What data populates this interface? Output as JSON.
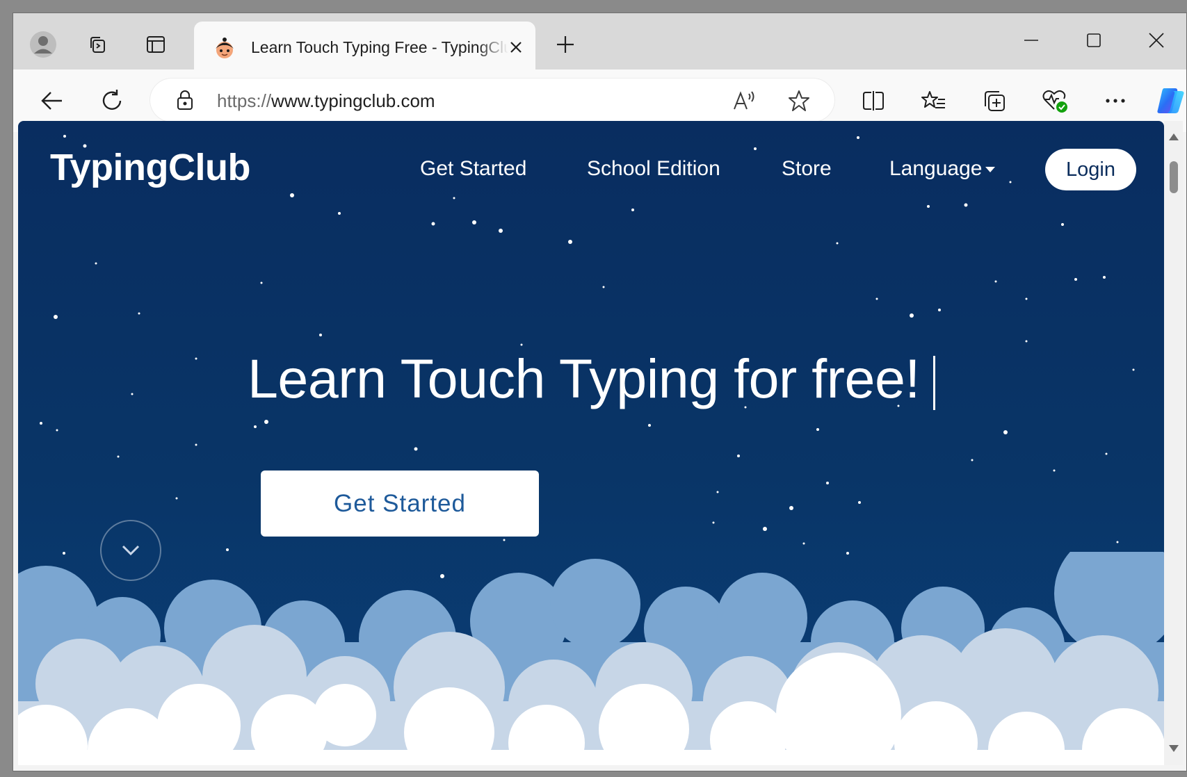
{
  "browser": {
    "tab": {
      "title": "Learn Touch Typing Free - TypingClub"
    },
    "address_bar": {
      "url_protocol": "https://",
      "url_host": "www.typingclub.com"
    },
    "icons": [
      "profile-icon",
      "workspaces-icon",
      "tab-actions-icon",
      "close-icon",
      "plus-icon",
      "back-icon",
      "reload-icon",
      "lock-icon",
      "read-aloud-icon",
      "star-icon",
      "split-screen-icon",
      "favorites-icon",
      "collections-icon",
      "browser-essentials-icon",
      "more-icon",
      "copilot-icon"
    ]
  },
  "site": {
    "logo": "TypingClub",
    "nav": {
      "get_started": "Get Started",
      "school_edition": "School Edition",
      "store": "Store",
      "language": "Language",
      "login": "Login"
    },
    "hero": {
      "headline": "Learn Touch Typing for free!",
      "cta": "Get Started"
    }
  },
  "colors": {
    "sky": "#093567",
    "cloud_back": "#7ba6d1",
    "cloud_mid": "#c7d6e7",
    "cloud_front": "#ffffff",
    "cta_text": "#1e5a9a"
  }
}
